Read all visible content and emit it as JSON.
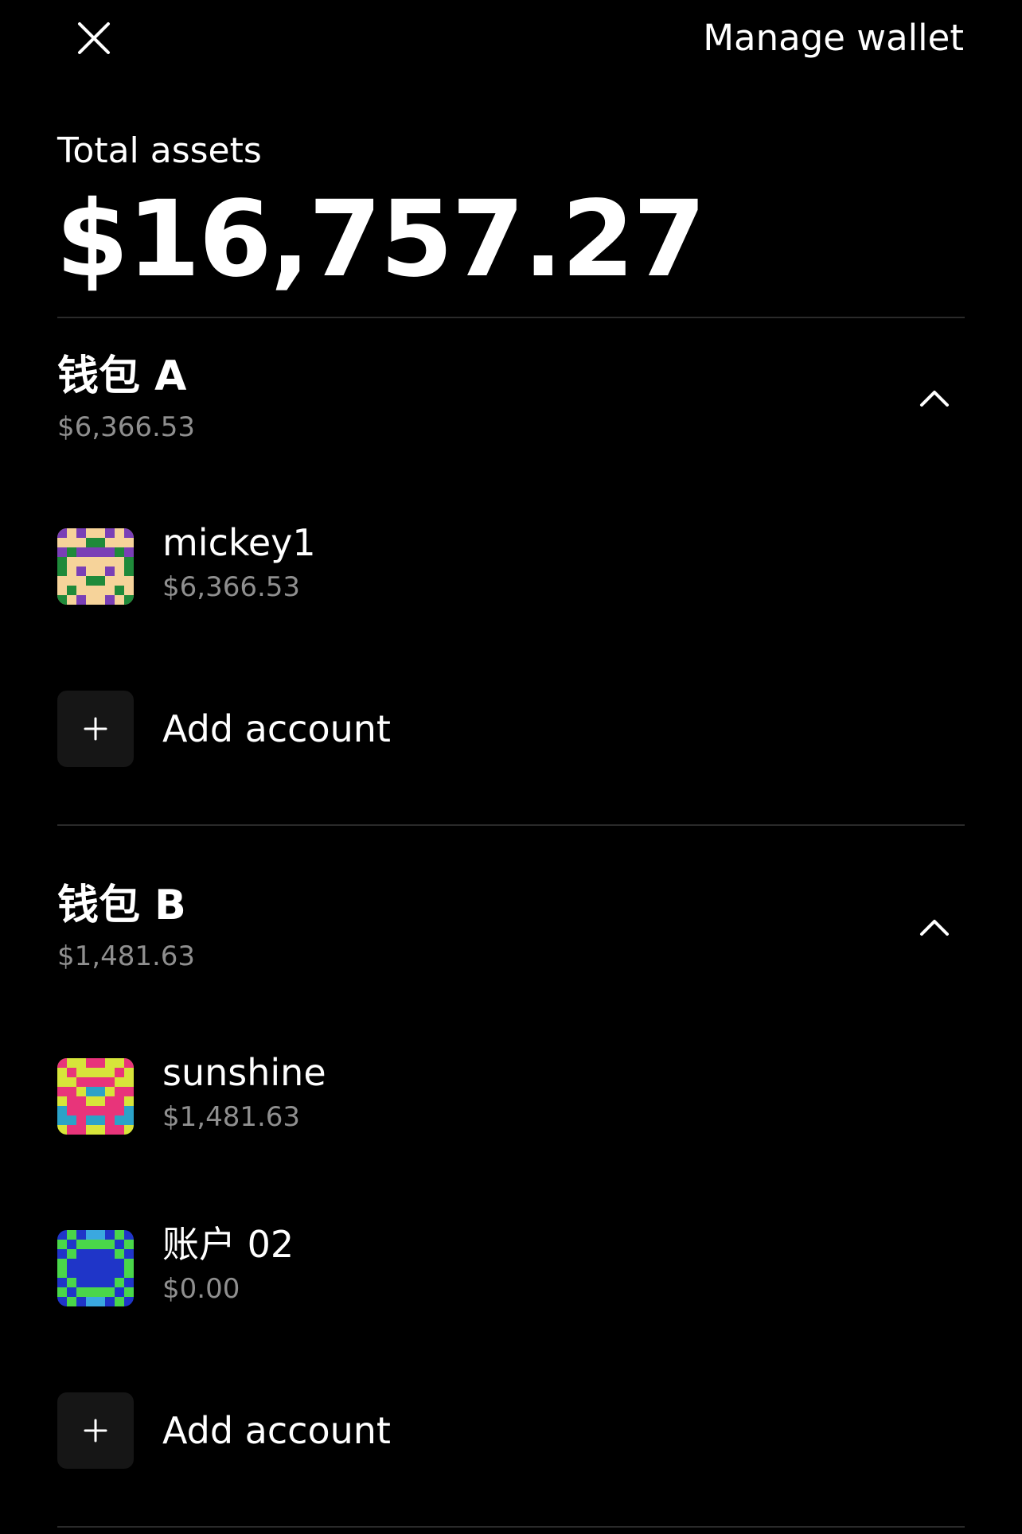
{
  "header": {
    "close_icon": "close-icon",
    "manage_label": "Manage wallet"
  },
  "summary": {
    "label": "Total assets",
    "value": "$16,757.27"
  },
  "wallets": [
    {
      "name": "钱包 A",
      "total": "$6,366.53",
      "expanded": true,
      "chevron_icon": "chevron-up-icon",
      "accounts": [
        {
          "name": "mickey1",
          "balance": "$6,366.53",
          "avatar_colors": [
            "#f6d39a",
            "#7a3fb6",
            "#1f8a3a"
          ]
        }
      ],
      "add_label": "Add account"
    },
    {
      "name": "钱包 B",
      "total": "$1,481.63",
      "expanded": true,
      "chevron_icon": "chevron-up-icon",
      "accounts": [
        {
          "name": "sunshine",
          "balance": "$1,481.63",
          "avatar_colors": [
            "#d7e43a",
            "#e8347a",
            "#2ba2c8"
          ]
        },
        {
          "name": "账户 02",
          "balance": "$0.00",
          "avatar_colors": [
            "#1f35c8",
            "#4ad64a",
            "#3aa8e0"
          ]
        }
      ],
      "add_label": "Add account"
    }
  ],
  "colors": {
    "background": "#000000",
    "text": "#ffffff",
    "muted": "#8f8f8f",
    "divider": "#2a2a2a",
    "add_box": "#161616"
  }
}
